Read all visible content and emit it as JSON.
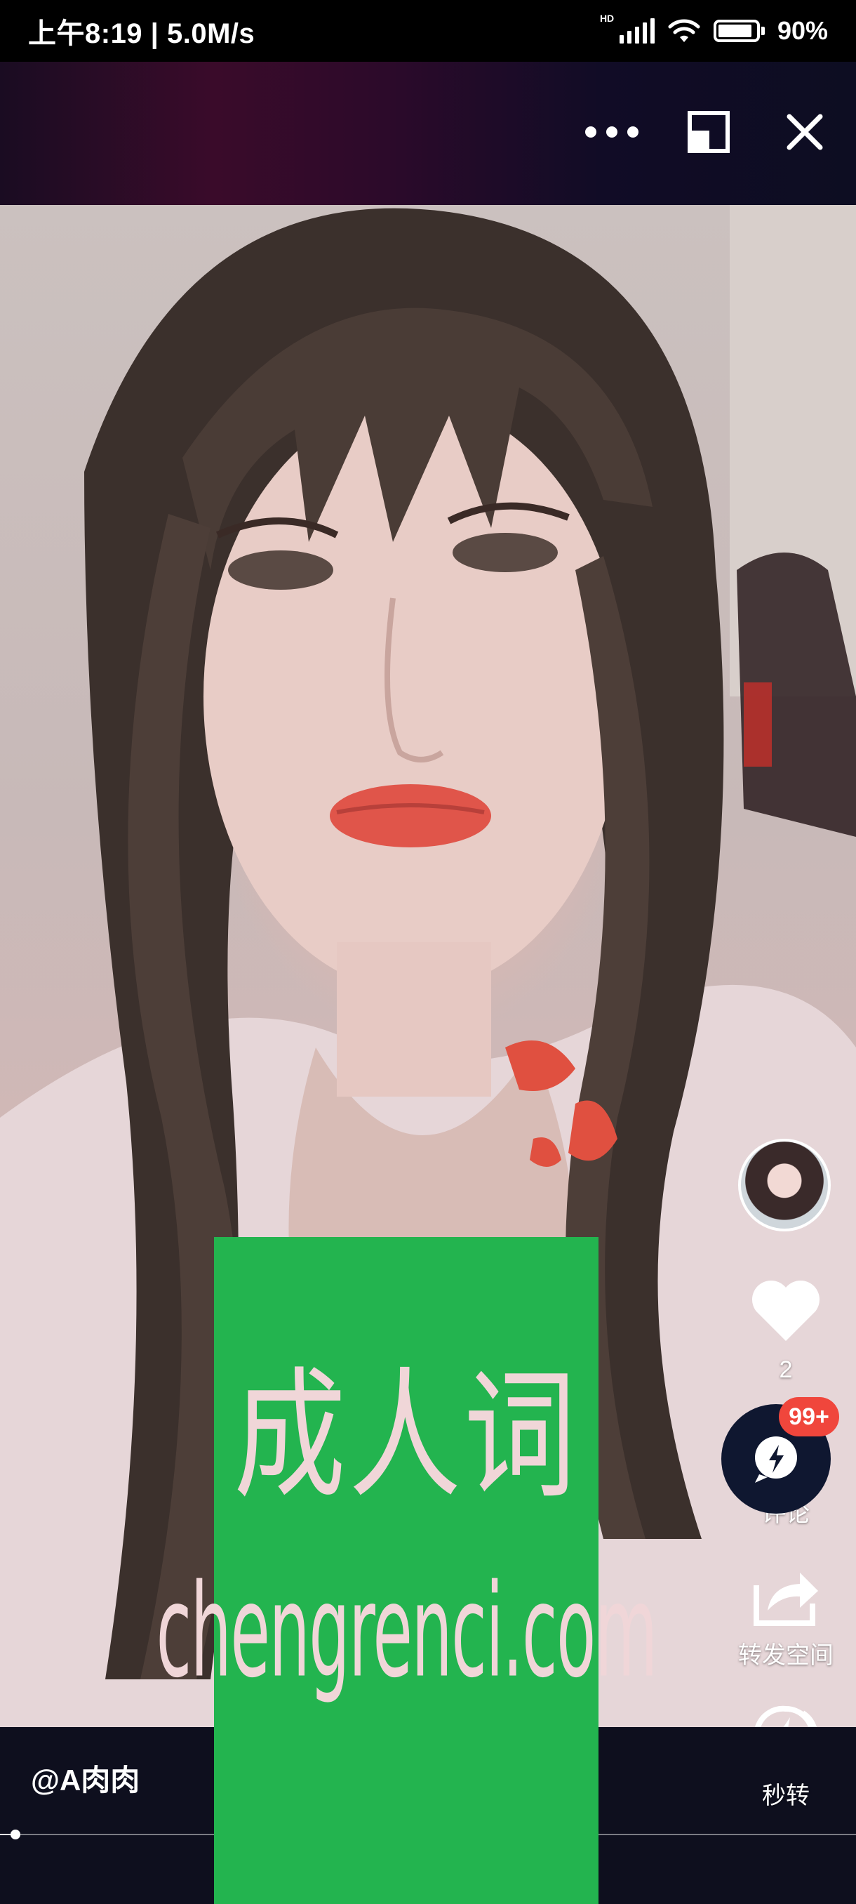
{
  "status_bar": {
    "time_speed": "上午8:19 | 5.0M/s",
    "network_badge": "HD",
    "battery_text": "90%",
    "battery_level": 0.9,
    "icons": [
      "signal-icon",
      "wifi-icon",
      "battery-icon"
    ]
  },
  "top_header": {
    "icons": [
      "more-icon",
      "minimize-window-icon",
      "close-icon"
    ]
  },
  "video": {
    "author": "@A肉肉",
    "progress": 0.018
  },
  "actions": {
    "like_count": "2",
    "comment_badge": "99+",
    "comment_label_partial": "评论",
    "share_label": "转发空间",
    "quick_share_label": "秒转"
  },
  "watermark": {
    "line1": "成人词",
    "line2": "chengrenci.com"
  },
  "colors": {
    "header_accent": "#3a0b2a",
    "badge_red": "#f0463c",
    "fab_navy": "#0f1730",
    "watermark_green": "#23b44f"
  }
}
